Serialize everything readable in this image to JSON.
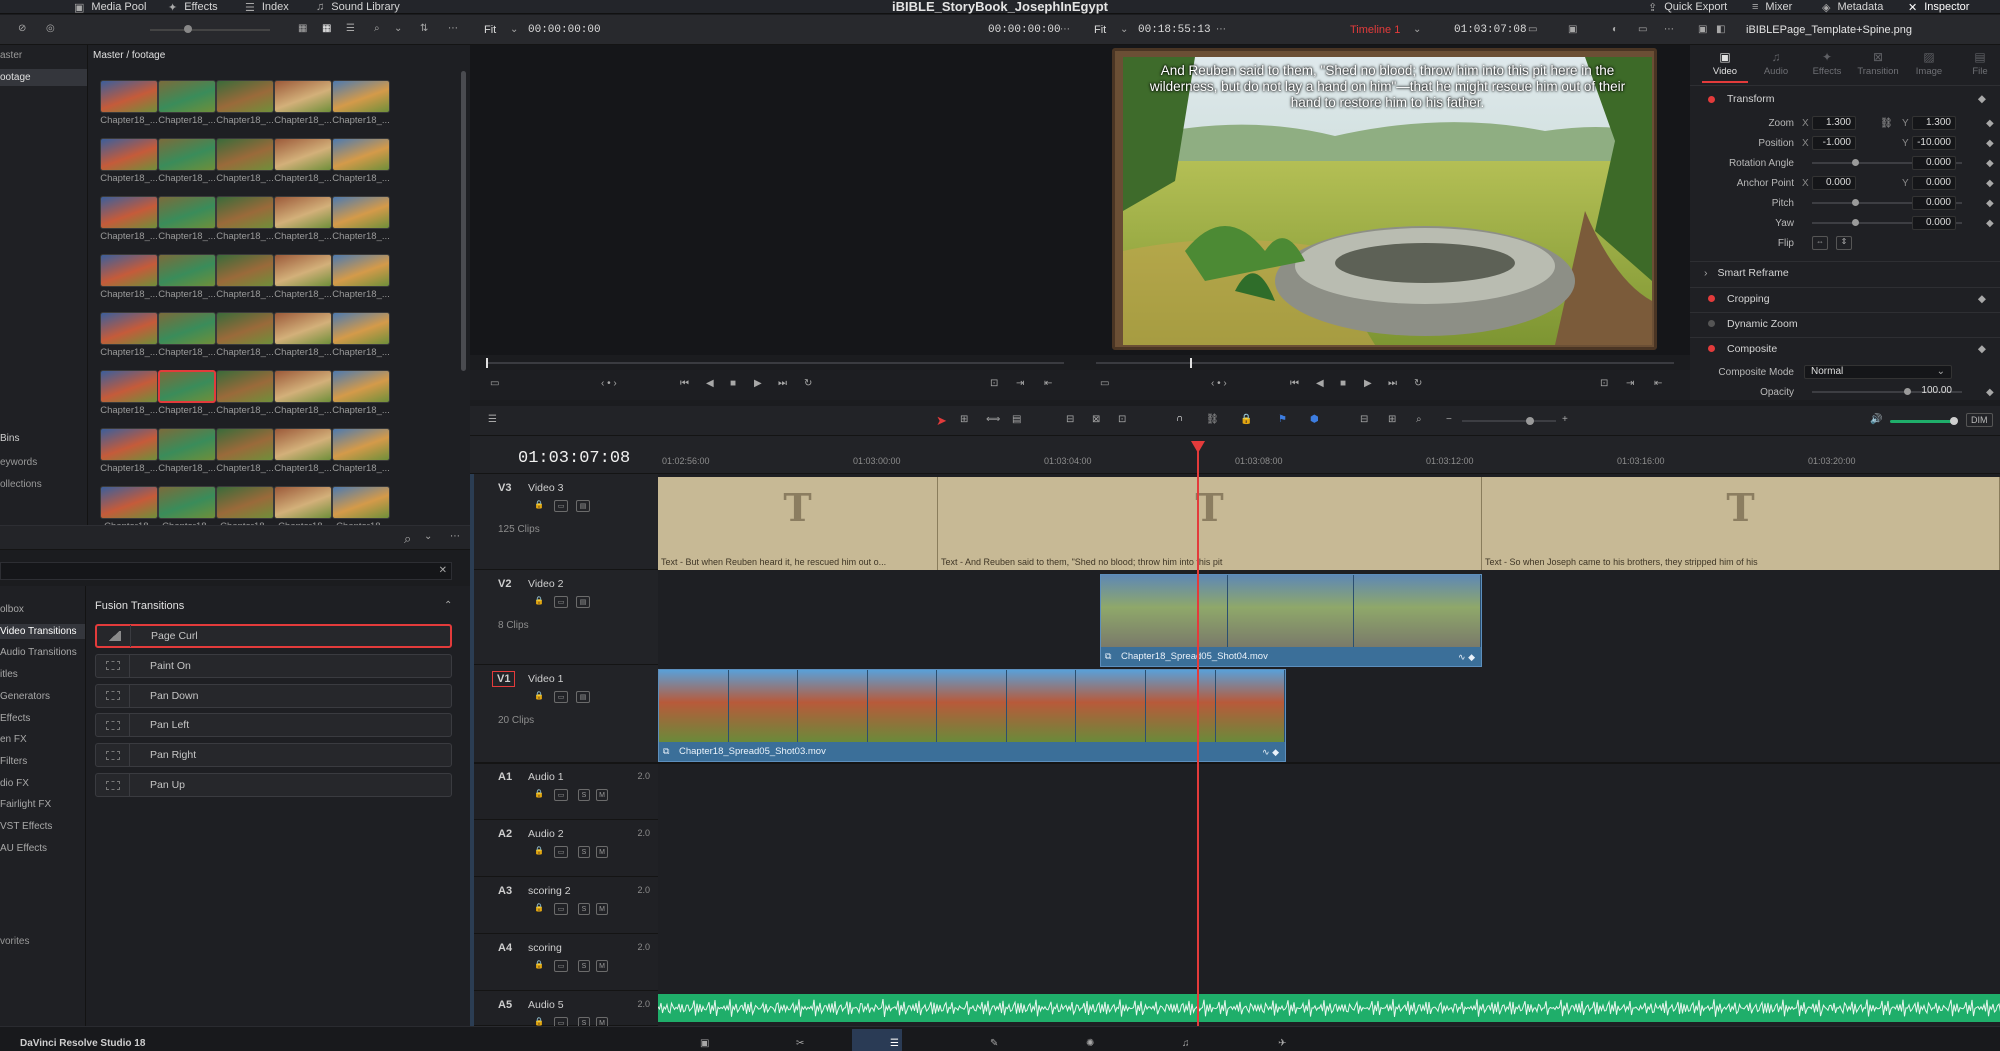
{
  "app": {
    "project_title": "iBIBLE_StoryBook_JosephInEgypt",
    "top_tabs": [
      "Media Pool",
      "Effects",
      "Index",
      "Sound Library"
    ],
    "right_tabs": [
      "Quick Export",
      "Mixer",
      "Metadata",
      "Inspector"
    ]
  },
  "source_viewer": {
    "fit_label": "Fit",
    "timecode_in": "00:00:00:00",
    "timecode_out": "00:00:00:00"
  },
  "timeline_viewer": {
    "fit_label": "Fit",
    "duration": "00:18:55:13",
    "timeline_name": "Timeline 1",
    "timecode": "01:03:07:08",
    "caption": "And Reuben said to them, \"Shed no blood; throw him into this pit here in the wilderness, but do not lay a hand on him\"—that he might rescue him out of their hand to restore him to his father."
  },
  "media_pool": {
    "breadcrumb": "Master / footage",
    "sidebar": [
      "aster",
      "ootage"
    ],
    "sidebar_bins": {
      "header": "Bins",
      "items": [
        "eywords",
        "ollections"
      ]
    },
    "thumb_label": "Chapter18_...",
    "thumb_label_short": "Chapter18_",
    "rows": 8,
    "cols": 5,
    "selected_index": 26
  },
  "effects": {
    "sidebar": [
      "olbox",
      "Video Transitions",
      "Audio Transitions",
      "itles",
      "Generators",
      "Effects",
      "en FX",
      "Filters",
      "dio FX",
      "Fairlight FX",
      "VST Effects",
      "AU Effects"
    ],
    "favorites": "vorites",
    "section_title": "Fusion Transitions",
    "items": [
      "Page Curl",
      "Paint On",
      "Pan Down",
      "Pan Left",
      "Pan Right",
      "Pan Up"
    ],
    "selected_item": "Page Curl"
  },
  "inspector": {
    "filename": "iBIBLEPage_Template+Spine.png",
    "tabs": [
      "Video",
      "Audio",
      "Effects",
      "Transition",
      "Image",
      "File"
    ],
    "transform": {
      "label": "Transform",
      "zoom_label": "Zoom",
      "zoom_x": "1.300",
      "zoom_y": "1.300",
      "position_label": "Position",
      "position_x": "-1.000",
      "position_y": "-10.000",
      "rotation_label": "Rotation Angle",
      "rotation": "0.000",
      "anchor_label": "Anchor Point",
      "anchor_x": "0.000",
      "anchor_y": "0.000",
      "pitch_label": "Pitch",
      "pitch": "0.000",
      "yaw_label": "Yaw",
      "yaw": "0.000",
      "flip_label": "Flip"
    },
    "smart_reframe": "Smart Reframe",
    "cropping": "Cropping",
    "dynamic_zoom": "Dynamic Zoom",
    "composite": {
      "label": "Composite",
      "mode_label": "Composite Mode",
      "mode": "Normal",
      "opacity_label": "Opacity",
      "opacity": "100.00"
    },
    "axis_x": "X",
    "axis_y": "Y"
  },
  "timeline": {
    "timecode": "01:03:07:08",
    "ruler": [
      "01:02:56:00",
      "01:03:00:00",
      "01:03:04:00",
      "01:03:08:00",
      "01:03:12:00",
      "01:03:16:00",
      "01:03:20:00"
    ],
    "dim_label": "DIM",
    "tracks": [
      {
        "id": "V3",
        "name": "Video 3",
        "count": "125 Clips"
      },
      {
        "id": "V2",
        "name": "Video 2",
        "count": "8 Clips"
      },
      {
        "id": "V1",
        "name": "Video 1",
        "count": "20 Clips"
      },
      {
        "id": "A1",
        "name": "Audio 1",
        "ch": "2.0"
      },
      {
        "id": "A2",
        "name": "Audio 2",
        "ch": "2.0"
      },
      {
        "id": "A3",
        "name": "scoring 2",
        "ch": "2.0"
      },
      {
        "id": "A4",
        "name": "scoring",
        "ch": "2.0"
      },
      {
        "id": "A5",
        "name": "Audio 5",
        "ch": "2.0"
      }
    ],
    "title_clips": [
      "Text - But when Reuben heard it, he rescued him out o...",
      "Text - And Reuben said to them, \"Shed no blood; throw him into this pit",
      "Text - So when Joseph came to his brothers, they stripped him of his"
    ],
    "v2_clip": "Chapter18_Spread05_Shot04.mov",
    "v1_clip": "Chapter18_Spread05_Shot03.mov",
    "title_glyph": "T",
    "solo_label": "S",
    "mute_label": "M"
  },
  "footer": {
    "app_name": "DaVinci Resolve Studio 18"
  },
  "colors": {
    "playhead": "#e33b3b",
    "title_clip": "#c7b995",
    "video_clip": "#3b6f99",
    "audio_clip": "#1fae6a"
  }
}
